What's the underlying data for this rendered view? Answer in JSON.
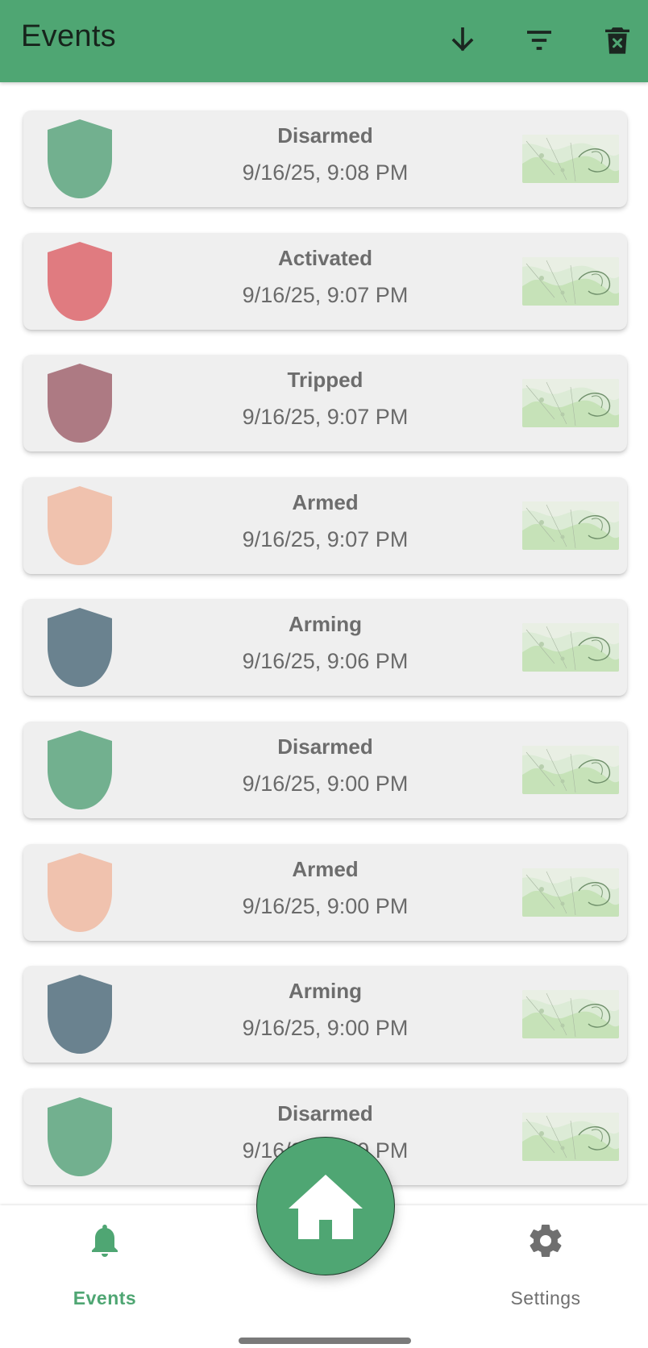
{
  "app_bar": {
    "title": "Events",
    "actions": [
      {
        "icon": "arrow-down-icon"
      },
      {
        "icon": "filter-icon"
      },
      {
        "icon": "delete-icon"
      }
    ],
    "background": "#4fa673"
  },
  "events": [
    {
      "status": "Disarmed",
      "time": "9/16/25, 9:08 PM",
      "shield_color": "#72b08f"
    },
    {
      "status": "Activated",
      "time": "9/16/25, 9:07 PM",
      "shield_color": "#e07b80"
    },
    {
      "status": "Tripped",
      "time": "9/16/25, 9:07 PM",
      "shield_color": "#ad7a83"
    },
    {
      "status": "Armed",
      "time": "9/16/25, 9:07 PM",
      "shield_color": "#f0c2ae"
    },
    {
      "status": "Arming",
      "time": "9/16/25, 9:06 PM",
      "shield_color": "#6a828f"
    },
    {
      "status": "Disarmed",
      "time": "9/16/25, 9:00 PM",
      "shield_color": "#72b08f"
    },
    {
      "status": "Armed",
      "time": "9/16/25, 9:00 PM",
      "shield_color": "#f0c2ae"
    },
    {
      "status": "Arming",
      "time": "9/16/25, 9:00 PM",
      "shield_color": "#6a828f"
    },
    {
      "status": "Disarmed",
      "time": "9/16/25, 8:59 PM",
      "shield_color": "#72b08f"
    }
  ],
  "bottom_nav": {
    "events_label": "Events",
    "settings_label": "Settings",
    "active_color": "#4fa673",
    "inactive_color": "#6f6f6f"
  },
  "fab": {
    "icon": "home-icon"
  }
}
